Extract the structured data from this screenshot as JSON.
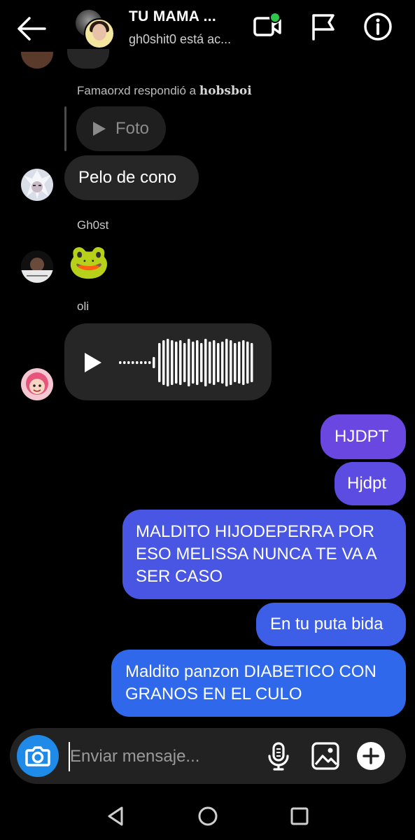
{
  "header": {
    "title": "TU MAMA ...",
    "subtitle": "gh0shit0 está ac...",
    "online_color": "#2fc54b"
  },
  "messages": {
    "reply_note_prefix": "Famaorxd respondió a ",
    "reply_note_target": "hobsboi",
    "reply_preview_label": "Foto",
    "msg1": "Pelo de cono",
    "sender_ghost": "Gh0st",
    "sticker": "🐸",
    "sender_oli": "oli",
    "out1": "HJDPT",
    "out2": "Hjdpt",
    "out3": "MALDITO HIJODEPERRA POR ESO MELISSA NUNCA TE VA A SER CASO",
    "out4": "En tu puta bida",
    "out5": "Maldito panzon DIABETICO CON GRANOS EN EL CULO"
  },
  "composer": {
    "placeholder": "Enviar mensaje..."
  },
  "icons": {
    "back": "arrow-left-icon",
    "video": "video-call-icon",
    "flag": "flag-icon",
    "info": "info-icon",
    "camera": "camera-icon",
    "mic": "microphone-icon",
    "gallery": "image-icon",
    "plus": "plus-icon",
    "nav_back": "triangle-back-icon",
    "nav_home": "circle-home-icon",
    "nav_recent": "square-recent-icon"
  },
  "colors": {
    "outgoing_top": "#6a47e0",
    "outgoing_bottom": "#2f68ea",
    "camera": "#1f8ae8",
    "incoming": "#262626"
  }
}
